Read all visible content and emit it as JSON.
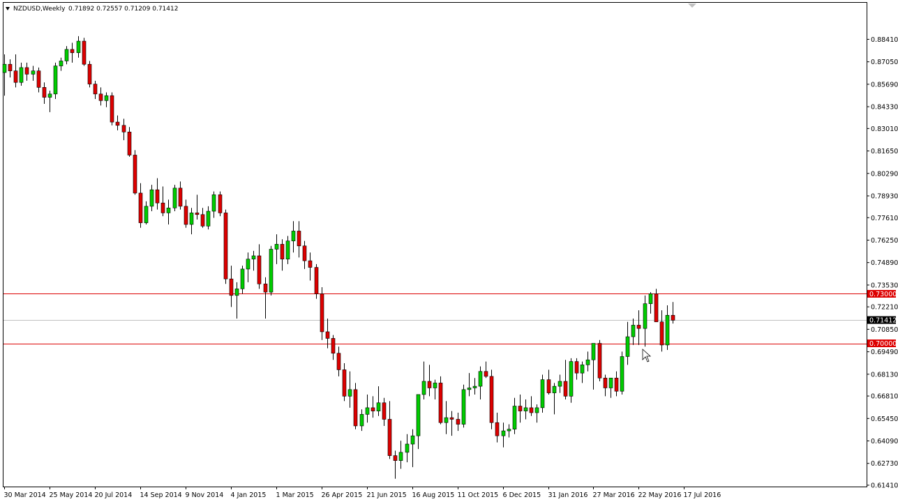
{
  "header": {
    "symbol": "NZDUSD,Weekly",
    "ohlc": "0.71892 0.72557 0.71209 0.71412",
    "dropdown_icon": "triangle-down-icon"
  },
  "colors": {
    "bull": "#00cc00",
    "bear": "#dd0000",
    "wick": "#000000",
    "level_line": "#dd0000",
    "current_line": "#c0c0c0",
    "current_badge": "#000000",
    "level_badge": "#dd0000"
  },
  "chart_data": {
    "type": "candlestick",
    "title": "NZDUSD,Weekly",
    "ylim": [
      0.6141,
      0.8923
    ],
    "yticks": [
      "0.88410",
      "0.87050",
      "0.85690",
      "0.84330",
      "0.83010",
      "0.81650",
      "0.80290",
      "0.78930",
      "0.77610",
      "0.76250",
      "0.74890",
      "0.73530",
      "0.72210",
      "0.70850",
      "0.69490",
      "0.68130",
      "0.66810",
      "0.65450",
      "0.64090",
      "0.62730",
      "0.61410"
    ],
    "xtick_labels": [
      "30 Mar 2014",
      "25 May 2014",
      "20 Jul 2014",
      "14 Sep 2014",
      "9 Nov 2014",
      "4 Jan 2015",
      "1 Mar 2015",
      "26 Apr 2015",
      "21 Jun 2015",
      "16 Aug 2015",
      "11 Oct 2015",
      "6 Dec 2015",
      "31 Jan 2016",
      "27 Mar 2016",
      "22 May 2016",
      "17 Jul 2016"
    ],
    "levels": [
      {
        "label": "0.73000",
        "value": 0.73
      },
      {
        "label": "0.70000",
        "value": 0.7
      }
    ],
    "current_price": {
      "label": "0.71412",
      "value": 0.71412
    },
    "candles": [
      [
        0.864,
        0.875,
        0.85,
        0.869
      ],
      [
        0.869,
        0.872,
        0.861,
        0.865
      ],
      [
        0.865,
        0.875,
        0.855,
        0.858
      ],
      [
        0.858,
        0.87,
        0.856,
        0.867
      ],
      [
        0.867,
        0.87,
        0.859,
        0.863
      ],
      [
        0.863,
        0.868,
        0.859,
        0.865
      ],
      [
        0.865,
        0.867,
        0.852,
        0.855
      ],
      [
        0.855,
        0.858,
        0.845,
        0.849
      ],
      [
        0.849,
        0.853,
        0.84,
        0.851
      ],
      [
        0.851,
        0.87,
        0.848,
        0.868
      ],
      [
        0.868,
        0.873,
        0.865,
        0.871
      ],
      [
        0.871,
        0.88,
        0.869,
        0.878
      ],
      [
        0.878,
        0.882,
        0.87,
        0.876
      ],
      [
        0.876,
        0.886,
        0.873,
        0.883
      ],
      [
        0.883,
        0.885,
        0.868,
        0.869
      ],
      [
        0.869,
        0.871,
        0.855,
        0.857
      ],
      [
        0.857,
        0.859,
        0.848,
        0.851
      ],
      [
        0.851,
        0.855,
        0.844,
        0.847
      ],
      [
        0.847,
        0.852,
        0.843,
        0.85
      ],
      [
        0.85,
        0.852,
        0.832,
        0.834
      ],
      [
        0.834,
        0.838,
        0.829,
        0.832
      ],
      [
        0.832,
        0.836,
        0.823,
        0.828
      ],
      [
        0.828,
        0.831,
        0.813,
        0.814
      ],
      [
        0.814,
        0.817,
        0.79,
        0.791
      ],
      [
        0.791,
        0.797,
        0.77,
        0.773
      ],
      [
        0.773,
        0.786,
        0.772,
        0.783
      ],
      [
        0.783,
        0.796,
        0.78,
        0.793
      ],
      [
        0.793,
        0.8,
        0.781,
        0.785
      ],
      [
        0.785,
        0.795,
        0.777,
        0.779
      ],
      [
        0.779,
        0.787,
        0.772,
        0.782
      ],
      [
        0.782,
        0.796,
        0.78,
        0.794
      ],
      [
        0.794,
        0.798,
        0.781,
        0.783
      ],
      [
        0.783,
        0.787,
        0.77,
        0.772
      ],
      [
        0.772,
        0.782,
        0.766,
        0.779
      ],
      [
        0.779,
        0.79,
        0.775,
        0.778
      ],
      [
        0.778,
        0.782,
        0.77,
        0.771
      ],
      [
        0.771,
        0.783,
        0.769,
        0.78
      ],
      [
        0.78,
        0.792,
        0.776,
        0.79
      ],
      [
        0.79,
        0.792,
        0.777,
        0.779
      ],
      [
        0.779,
        0.781,
        0.736,
        0.739
      ],
      [
        0.739,
        0.747,
        0.722,
        0.729
      ],
      [
        0.729,
        0.737,
        0.715,
        0.733
      ],
      [
        0.733,
        0.747,
        0.73,
        0.745
      ],
      [
        0.745,
        0.755,
        0.737,
        0.751
      ],
      [
        0.751,
        0.756,
        0.744,
        0.753
      ],
      [
        0.753,
        0.76,
        0.733,
        0.736
      ],
      [
        0.736,
        0.74,
        0.715,
        0.731
      ],
      [
        0.731,
        0.759,
        0.729,
        0.757
      ],
      [
        0.757,
        0.766,
        0.748,
        0.76
      ],
      [
        0.76,
        0.763,
        0.744,
        0.751
      ],
      [
        0.751,
        0.765,
        0.748,
        0.762
      ],
      [
        0.762,
        0.774,
        0.755,
        0.768
      ],
      [
        0.768,
        0.774,
        0.752,
        0.759
      ],
      [
        0.759,
        0.762,
        0.745,
        0.75
      ],
      [
        0.75,
        0.755,
        0.738,
        0.746
      ],
      [
        0.746,
        0.748,
        0.727,
        0.73
      ],
      [
        0.73,
        0.734,
        0.702,
        0.707
      ],
      [
        0.707,
        0.715,
        0.697,
        0.703
      ],
      [
        0.703,
        0.705,
        0.69,
        0.694
      ],
      [
        0.694,
        0.698,
        0.68,
        0.684
      ],
      [
        0.684,
        0.688,
        0.665,
        0.668
      ],
      [
        0.668,
        0.683,
        0.661,
        0.672
      ],
      [
        0.672,
        0.676,
        0.648,
        0.65
      ],
      [
        0.65,
        0.66,
        0.647,
        0.657
      ],
      [
        0.657,
        0.669,
        0.652,
        0.661
      ],
      [
        0.661,
        0.668,
        0.655,
        0.659
      ],
      [
        0.659,
        0.674,
        0.656,
        0.664
      ],
      [
        0.664,
        0.667,
        0.65,
        0.654
      ],
      [
        0.654,
        0.665,
        0.63,
        0.632
      ],
      [
        0.632,
        0.635,
        0.618,
        0.629
      ],
      [
        0.629,
        0.641,
        0.624,
        0.634
      ],
      [
        0.634,
        0.645,
        0.628,
        0.639
      ],
      [
        0.639,
        0.648,
        0.625,
        0.644
      ],
      [
        0.644,
        0.653,
        0.636,
        0.669
      ],
      [
        0.669,
        0.689,
        0.666,
        0.677
      ],
      [
        0.677,
        0.687,
        0.668,
        0.673
      ],
      [
        0.673,
        0.678,
        0.666,
        0.676
      ],
      [
        0.676,
        0.68,
        0.651,
        0.652
      ],
      [
        0.652,
        0.665,
        0.645,
        0.655
      ],
      [
        0.655,
        0.659,
        0.644,
        0.654
      ],
      [
        0.654,
        0.658,
        0.647,
        0.651
      ],
      [
        0.651,
        0.675,
        0.649,
        0.672
      ],
      [
        0.672,
        0.682,
        0.668,
        0.673
      ],
      [
        0.673,
        0.679,
        0.669,
        0.674
      ],
      [
        0.674,
        0.686,
        0.666,
        0.683
      ],
      [
        0.683,
        0.689,
        0.679,
        0.68
      ],
      [
        0.68,
        0.684,
        0.648,
        0.652
      ],
      [
        0.652,
        0.658,
        0.64,
        0.644
      ],
      [
        0.644,
        0.652,
        0.637,
        0.647
      ],
      [
        0.647,
        0.651,
        0.643,
        0.648
      ],
      [
        0.648,
        0.667,
        0.645,
        0.662
      ],
      [
        0.662,
        0.669,
        0.652,
        0.659
      ],
      [
        0.659,
        0.666,
        0.654,
        0.661
      ],
      [
        0.661,
        0.668,
        0.656,
        0.658
      ],
      [
        0.658,
        0.663,
        0.652,
        0.661
      ],
      [
        0.661,
        0.681,
        0.658,
        0.678
      ],
      [
        0.678,
        0.684,
        0.669,
        0.67
      ],
      [
        0.67,
        0.676,
        0.657,
        0.674
      ],
      [
        0.674,
        0.681,
        0.67,
        0.677
      ],
      [
        0.677,
        0.69,
        0.666,
        0.668
      ],
      [
        0.668,
        0.691,
        0.664,
        0.689
      ],
      [
        0.689,
        0.691,
        0.678,
        0.682
      ],
      [
        0.682,
        0.689,
        0.676,
        0.687
      ],
      [
        0.687,
        0.695,
        0.683,
        0.69
      ],
      [
        0.69,
        0.696,
        0.672,
        0.7
      ],
      [
        0.7,
        0.702,
        0.677,
        0.679
      ],
      [
        0.679,
        0.681,
        0.668,
        0.673
      ],
      [
        0.673,
        0.679,
        0.667,
        0.679
      ],
      [
        0.679,
        0.683,
        0.668,
        0.671
      ],
      [
        0.671,
        0.695,
        0.669,
        0.692
      ],
      [
        0.692,
        0.713,
        0.687,
        0.704
      ],
      [
        0.704,
        0.715,
        0.699,
        0.711
      ],
      [
        0.711,
        0.72,
        0.699,
        0.709
      ],
      [
        0.709,
        0.729,
        0.698,
        0.724
      ],
      [
        0.724,
        0.731,
        0.718,
        0.73
      ],
      [
        0.73,
        0.733,
        0.715,
        0.713
      ],
      [
        0.713,
        0.72,
        0.695,
        0.699
      ],
      [
        0.699,
        0.723,
        0.696,
        0.717
      ],
      [
        0.717,
        0.725,
        0.712,
        0.714
      ]
    ]
  }
}
